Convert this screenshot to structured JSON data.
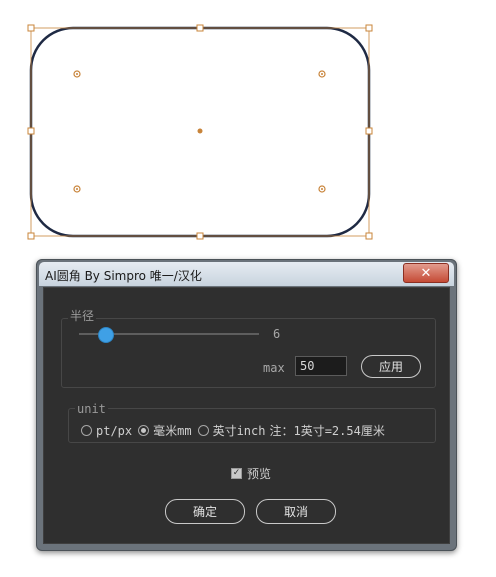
{
  "canvas": {
    "artwork": "rounded-rectangle-shape",
    "stroke_color": "#1f2a44",
    "handle_color": "#c8843a"
  },
  "dialog": {
    "title": "AI圆角 By Simpro 唯一/汉化",
    "close_icon": "close-icon",
    "radius_group": {
      "label": "半径",
      "slider_value": "6",
      "slider_fraction": 0.1,
      "max_label": "max",
      "max_value": "50",
      "apply_label": "应用"
    },
    "unit_group": {
      "label": "unit",
      "options": [
        {
          "label": "pt/px",
          "checked": false
        },
        {
          "label": "毫米mm",
          "checked": true
        },
        {
          "label": "英寸inch",
          "checked": false
        }
      ],
      "note": "注：1英寸=2.54厘米"
    },
    "preview": {
      "label": "预览",
      "checked": true
    },
    "ok_label": "确定",
    "cancel_label": "取消"
  },
  "colors": {
    "accent": "#3fa0e6",
    "dialog_bg": "#2f2f2f",
    "window_frame": "#6b737b"
  }
}
